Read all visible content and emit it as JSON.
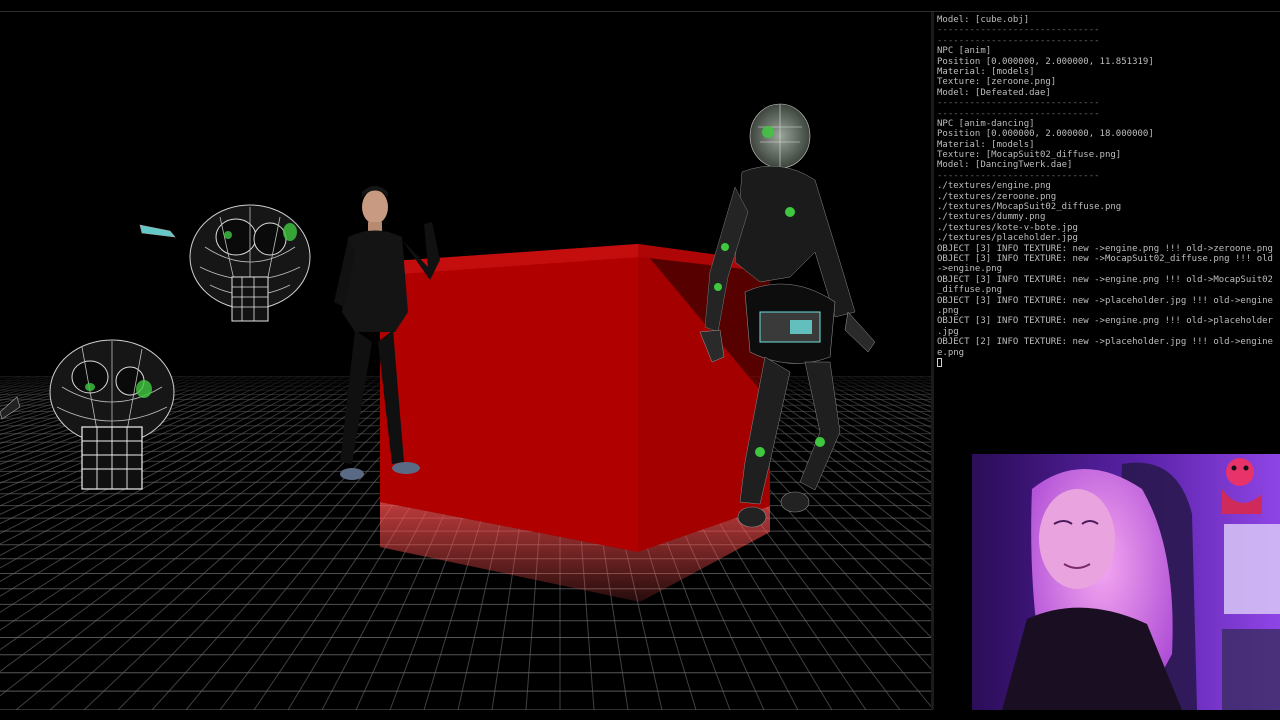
{
  "console": {
    "lines": [
      {
        "text": "Model: [cube.obj]",
        "kind": "text"
      },
      {
        "text": "------------------------------",
        "kind": "sep"
      },
      {
        "text": "------------------------------",
        "kind": "sep"
      },
      {
        "text": "NPC [anim]",
        "kind": "text"
      },
      {
        "text": "Position [0.000000, 2.000000, 11.851319]",
        "kind": "text"
      },
      {
        "text": "Material: [models]",
        "kind": "text"
      },
      {
        "text": "Texture: [zeroone.png]",
        "kind": "text"
      },
      {
        "text": "Model: [Defeated.dae]",
        "kind": "text"
      },
      {
        "text": "------------------------------",
        "kind": "sep"
      },
      {
        "text": "------------------------------",
        "kind": "sep"
      },
      {
        "text": "NPC [anim-dancing]",
        "kind": "text"
      },
      {
        "text": "Position [0.000000, 2.000000, 18.000000]",
        "kind": "text"
      },
      {
        "text": "Material: [models]",
        "kind": "text"
      },
      {
        "text": "Texture: [MocapSuit02_diffuse.png]",
        "kind": "text"
      },
      {
        "text": "Model: [DancingTwerk.dae]",
        "kind": "text"
      },
      {
        "text": "------------------------------",
        "kind": "sep"
      },
      {
        "text": "./textures/engine.png",
        "kind": "text"
      },
      {
        "text": "./textures/zeroone.png",
        "kind": "text"
      },
      {
        "text": "./textures/MocapSuit02_diffuse.png",
        "kind": "text"
      },
      {
        "text": "./textures/dummy.png",
        "kind": "text"
      },
      {
        "text": "./textures/kote-v-bote.jpg",
        "kind": "text"
      },
      {
        "text": "./textures/placeholder.jpg",
        "kind": "text"
      },
      {
        "text": "OBJECT [3] INFO TEXTURE: new ->engine.png !!! old->zeroone.png",
        "kind": "text"
      },
      {
        "text": "OBJECT [3] INFO TEXTURE: new ->MocapSuit02_diffuse.png !!! old",
        "kind": "text"
      },
      {
        "text": "->engine.png",
        "kind": "text"
      },
      {
        "text": "OBJECT [3] INFO TEXTURE: new ->engine.png !!! old->MocapSuit02",
        "kind": "text"
      },
      {
        "text": "_diffuse.png",
        "kind": "text"
      },
      {
        "text": "OBJECT [3] INFO TEXTURE: new ->placeholder.jpg !!! old->engine",
        "kind": "text"
      },
      {
        "text": ".png",
        "kind": "text"
      },
      {
        "text": "OBJECT [3] INFO TEXTURE: new ->engine.png !!! old->placeholder",
        "kind": "text"
      },
      {
        "text": ".jpg",
        "kind": "text"
      },
      {
        "text": "OBJECT [2] INFO TEXTURE: new ->placeholder.jpg !!! old->engine",
        "kind": "text"
      },
      {
        "text": "e.png",
        "kind": "text"
      }
    ]
  },
  "scene": {
    "objects": [
      {
        "name": "red-cube",
        "icon": "cube-icon"
      },
      {
        "name": "wireframe-monkey-head",
        "icon": "monkey-head-icon"
      },
      {
        "name": "mocap-character-standing",
        "icon": "person-icon"
      },
      {
        "name": "mocap-character-dancing",
        "icon": "person-icon"
      }
    ]
  },
  "colors": {
    "background": "#000000",
    "grid": "#5a5a5a",
    "cube": "#b30000",
    "console_text": "#bdbdbd",
    "wire_green": "#3fc83f",
    "webcam_purple": "#6a2bc8"
  }
}
